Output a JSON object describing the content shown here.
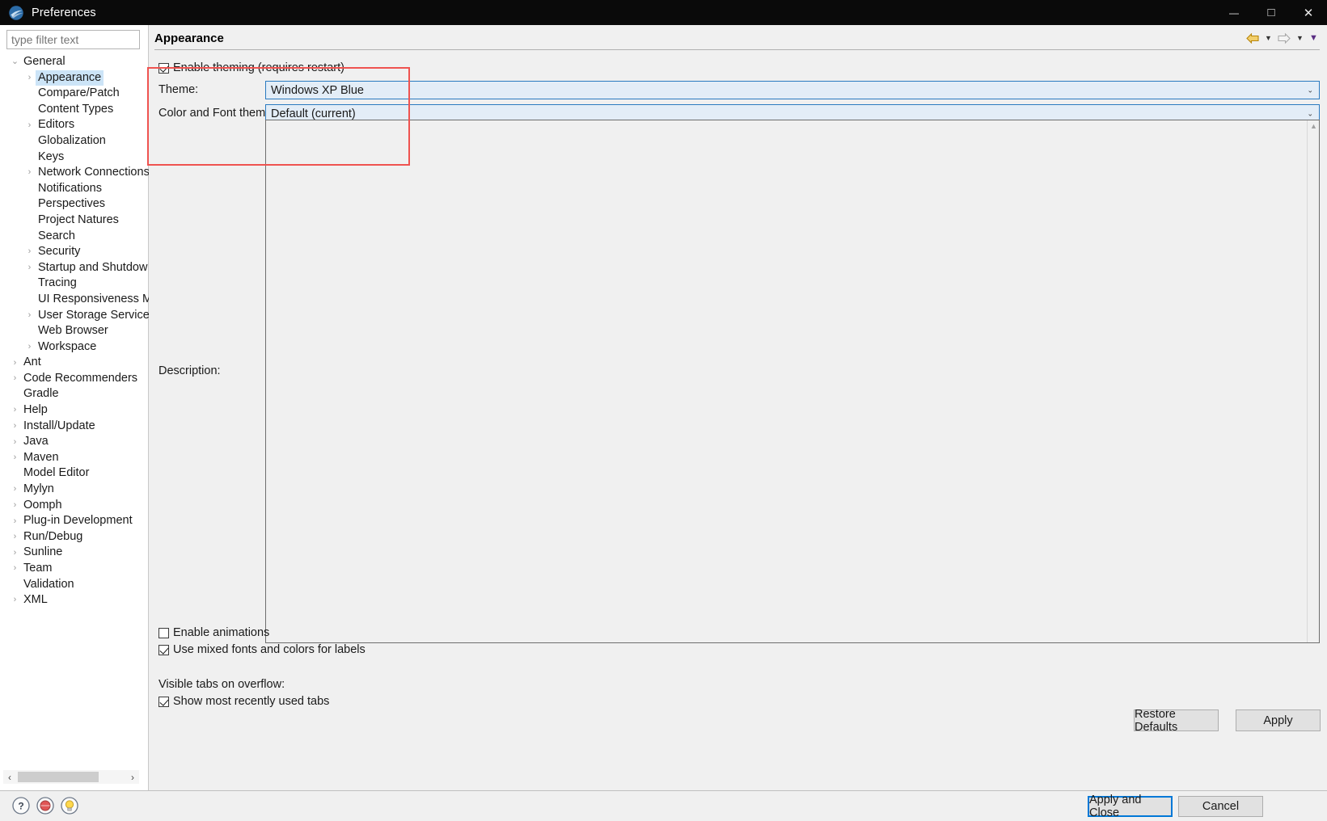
{
  "window": {
    "title": "Preferences",
    "logo_icon": "eclipse-logo-icon",
    "minimize_icon": "minimize-icon",
    "maximize_icon": "maximize-icon",
    "close_icon": "close-icon",
    "minimize_glyph": "—",
    "maximize_glyph": "□",
    "close_glyph": "✕"
  },
  "filter": {
    "placeholder": "type filter text",
    "value": ""
  },
  "tree": {
    "items": [
      {
        "label": "General",
        "level": 0,
        "arrow": "⌄",
        "expanded": true,
        "selected": false
      },
      {
        "label": "Appearance",
        "level": 1,
        "arrow": "›",
        "expanded": false,
        "selected": true
      },
      {
        "label": "Compare/Patch",
        "level": 1,
        "arrow": "",
        "expanded": false,
        "selected": false
      },
      {
        "label": "Content Types",
        "level": 1,
        "arrow": "",
        "expanded": false,
        "selected": false
      },
      {
        "label": "Editors",
        "level": 1,
        "arrow": "›",
        "expanded": false,
        "selected": false
      },
      {
        "label": "Globalization",
        "level": 1,
        "arrow": "",
        "expanded": false,
        "selected": false
      },
      {
        "label": "Keys",
        "level": 1,
        "arrow": "",
        "expanded": false,
        "selected": false
      },
      {
        "label": "Network Connections",
        "level": 1,
        "arrow": "›",
        "expanded": false,
        "selected": false
      },
      {
        "label": "Notifications",
        "level": 1,
        "arrow": "",
        "expanded": false,
        "selected": false
      },
      {
        "label": "Perspectives",
        "level": 1,
        "arrow": "",
        "expanded": false,
        "selected": false
      },
      {
        "label": "Project Natures",
        "level": 1,
        "arrow": "",
        "expanded": false,
        "selected": false
      },
      {
        "label": "Search",
        "level": 1,
        "arrow": "",
        "expanded": false,
        "selected": false
      },
      {
        "label": "Security",
        "level": 1,
        "arrow": "›",
        "expanded": false,
        "selected": false
      },
      {
        "label": "Startup and Shutdow",
        "level": 1,
        "arrow": "›",
        "expanded": false,
        "selected": false
      },
      {
        "label": "Tracing",
        "level": 1,
        "arrow": "",
        "expanded": false,
        "selected": false
      },
      {
        "label": "UI Responsiveness M",
        "level": 1,
        "arrow": "",
        "expanded": false,
        "selected": false
      },
      {
        "label": "User Storage Service",
        "level": 1,
        "arrow": "›",
        "expanded": false,
        "selected": false
      },
      {
        "label": "Web Browser",
        "level": 1,
        "arrow": "",
        "expanded": false,
        "selected": false
      },
      {
        "label": "Workspace",
        "level": 1,
        "arrow": "›",
        "expanded": false,
        "selected": false
      },
      {
        "label": "Ant",
        "level": 0,
        "arrow": "›",
        "expanded": false,
        "selected": false
      },
      {
        "label": "Code Recommenders",
        "level": 0,
        "arrow": "›",
        "expanded": false,
        "selected": false
      },
      {
        "label": "Gradle",
        "level": 0,
        "arrow": "",
        "expanded": false,
        "selected": false
      },
      {
        "label": "Help",
        "level": 0,
        "arrow": "›",
        "expanded": false,
        "selected": false
      },
      {
        "label": "Install/Update",
        "level": 0,
        "arrow": "›",
        "expanded": false,
        "selected": false
      },
      {
        "label": "Java",
        "level": 0,
        "arrow": "›",
        "expanded": false,
        "selected": false
      },
      {
        "label": "Maven",
        "level": 0,
        "arrow": "›",
        "expanded": false,
        "selected": false
      },
      {
        "label": "Model Editor",
        "level": 0,
        "arrow": "",
        "expanded": false,
        "selected": false
      },
      {
        "label": "Mylyn",
        "level": 0,
        "arrow": "›",
        "expanded": false,
        "selected": false
      },
      {
        "label": "Oomph",
        "level": 0,
        "arrow": "›",
        "expanded": false,
        "selected": false
      },
      {
        "label": "Plug-in Development",
        "level": 0,
        "arrow": "›",
        "expanded": false,
        "selected": false
      },
      {
        "label": "Run/Debug",
        "level": 0,
        "arrow": "›",
        "expanded": false,
        "selected": false
      },
      {
        "label": "Sunline",
        "level": 0,
        "arrow": "›",
        "expanded": false,
        "selected": false
      },
      {
        "label": "Team",
        "level": 0,
        "arrow": "›",
        "expanded": false,
        "selected": false
      },
      {
        "label": "Validation",
        "level": 0,
        "arrow": "",
        "expanded": false,
        "selected": false
      },
      {
        "label": "XML",
        "level": 0,
        "arrow": "›",
        "expanded": false,
        "selected": false
      }
    ],
    "hscroll": {
      "left_glyph": "‹",
      "right_glyph": "›"
    }
  },
  "page": {
    "title": "Appearance",
    "nav": {
      "back_icon": "back-arrow-icon",
      "back_caret_icon": "chevron-down-icon",
      "forward_icon": "forward-arrow-icon",
      "forward_caret_icon": "chevron-down-icon",
      "menu_caret_icon": "view-menu-chevron-down-icon",
      "caret_glyph": "▼"
    },
    "enable_theming": {
      "label": "Enable theming (requires restart)",
      "checked": true
    },
    "theme": {
      "label": "Theme:",
      "value": "Windows XP Blue",
      "caret_glyph": "⌄"
    },
    "color_font_theme": {
      "label": "Color and Font theme:",
      "value": "Default (current)",
      "caret_glyph": "⌄"
    },
    "description": {
      "label": "Description:",
      "value": "",
      "scroll_up_glyph": "▲"
    },
    "enable_animations": {
      "label": "Enable animations",
      "checked": false
    },
    "use_mixed_fonts": {
      "label": "Use mixed fonts and colors for labels",
      "checked": true
    },
    "visible_tabs_label": "Visible tabs on overflow:",
    "show_mru_tabs": {
      "label": "Show most recently used tabs",
      "checked": true
    },
    "restore_defaults_label": "Restore Defaults",
    "apply_label": "Apply"
  },
  "footer": {
    "help_icon": "help-question-icon",
    "record_icon": "record-red-icon",
    "tip_icon": "lightbulb-tip-icon",
    "help_glyph": "?",
    "apply_and_close_label": "Apply and Close",
    "cancel_label": "Cancel"
  },
  "colors": {
    "accent": "#0078d7",
    "combo_border": "#2a7ac0",
    "combo_bg": "#e3edf7",
    "selection": "#cce4f7",
    "annotation_red": "#ef5350",
    "titlebar": "#0a0a0a",
    "panel_bg": "#f0f0f0"
  }
}
